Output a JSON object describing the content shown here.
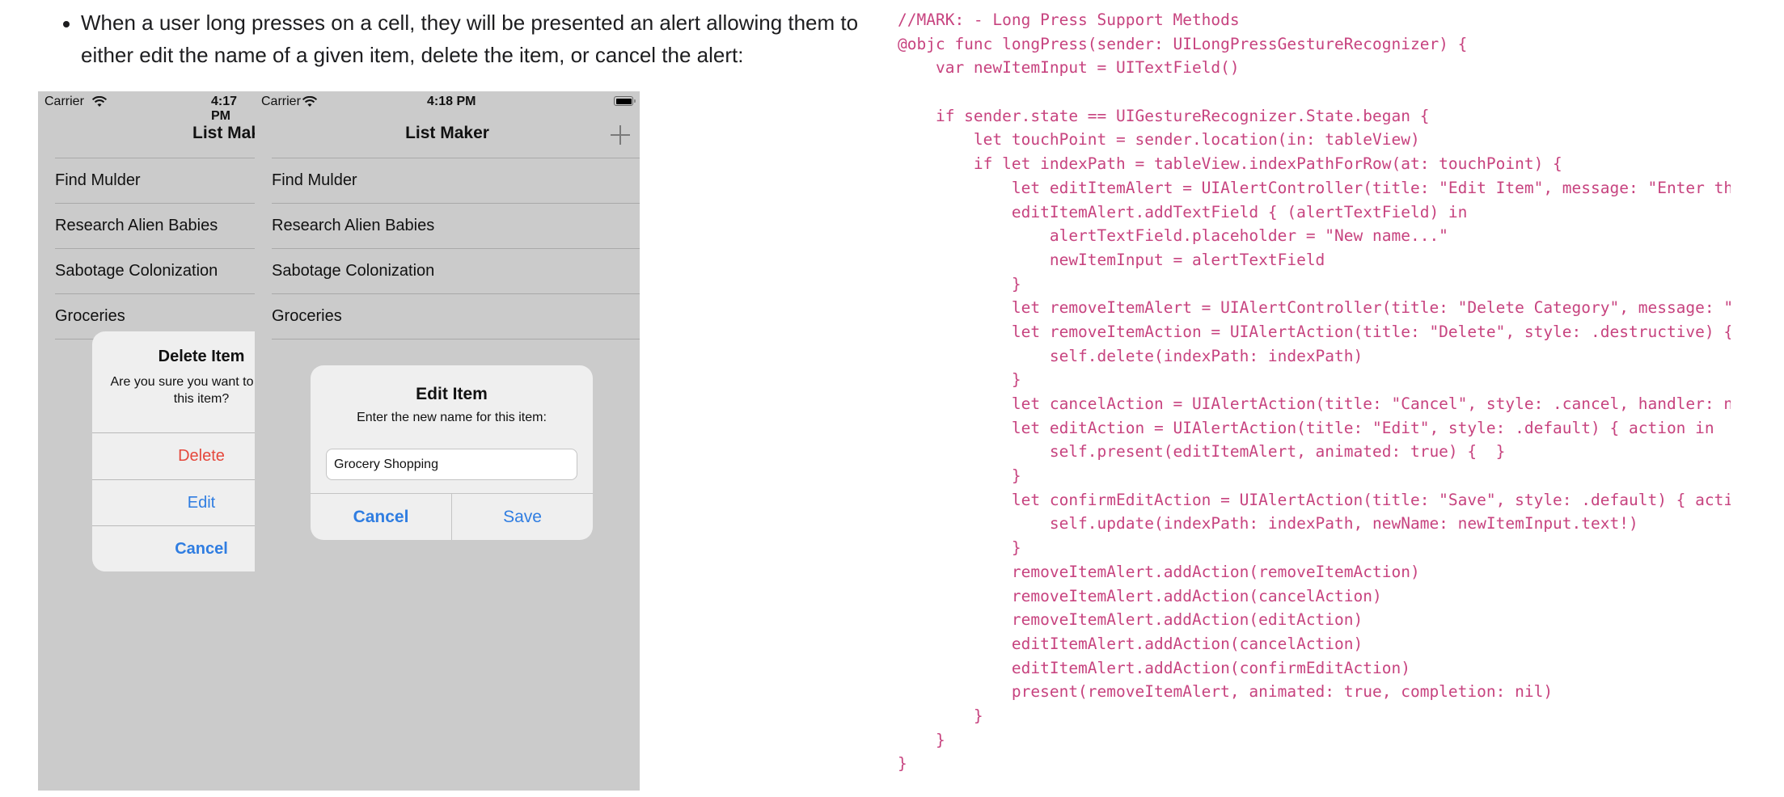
{
  "intro": {
    "text": "When a user long presses on a cell, they will be presented an alert allowing them to either edit the name of a given item, delete the item, or cancel the alert:"
  },
  "phone1": {
    "status": {
      "carrier": "Carrier",
      "time": "4:17 PM"
    },
    "nav_title": "List Maker",
    "items": [
      "Find Mulder",
      "Research Alien Babies",
      "Sabotage Colonization",
      "Groceries"
    ],
    "alert": {
      "title": "Delete Item",
      "message": "Are you sure you want to delete this item?",
      "actions": [
        {
          "label": "Delete",
          "style": "destructive"
        },
        {
          "label": "Edit",
          "style": "default"
        },
        {
          "label": "Cancel",
          "style": "cancel"
        }
      ]
    }
  },
  "phone2": {
    "status": {
      "carrier": "Carrier",
      "time": "4:18 PM"
    },
    "nav_title": "List Maker",
    "add_icon": "plus-icon",
    "items": [
      "Find Mulder",
      "Research Alien Babies",
      "Sabotage Colonization",
      "Groceries"
    ],
    "alert": {
      "title": "Edit Item",
      "message": "Enter the new name for this item:",
      "field_value": "Grocery Shopping",
      "cancel_label": "Cancel",
      "save_label": "Save"
    }
  },
  "colors": {
    "code": "#c7437f",
    "destructive": "#e5483c",
    "tint": "#2f7de1",
    "dimmed_background": "#cbcbcb"
  },
  "code_lines": [
    "//MARK: - Long Press Support Methods",
    "@objc func longPress(sender: UILongPressGestureRecognizer) {",
    "    var newItemInput = UITextField()",
    "",
    "    if sender.state == UIGestureRecognizer.State.began {",
    "        let touchPoint = sender.location(in: tableView)",
    "        if let indexPath = tableView.indexPathForRow(at: touchPoint) {",
    "            let editItemAlert = UIAlertController(title: \"Edit Item\", message: \"Enter the new name for this item:\", preferredStyle: .alert)",
    "            editItemAlert.addTextField { (alertTextField) in",
    "                alertTextField.placeholder = \"New name...\"",
    "                newItemInput = alertTextField",
    "            }",
    "            let removeItemAlert = UIAlertController(title: \"Delete Category\", message: \"Are you sure you want to delete this item?\", preferredStyle: .alert)",
    "            let removeItemAction = UIAlertAction(title: \"Delete\", style: .destructive) { action in",
    "                self.delete(indexPath: indexPath)",
    "            }",
    "            let cancelAction = UIAlertAction(title: \"Cancel\", style: .cancel, handler: nil)",
    "            let editAction = UIAlertAction(title: \"Edit\", style: .default) { action in",
    "                self.present(editItemAlert, animated: true) {  }",
    "            }",
    "            let confirmEditAction = UIAlertAction(title: \"Save\", style: .default) { action in",
    "                self.update(indexPath: indexPath, newName: newItemInput.text!)",
    "            }",
    "            removeItemAlert.addAction(removeItemAction)",
    "            removeItemAlert.addAction(cancelAction)",
    "            removeItemAlert.addAction(editAction)",
    "            editItemAlert.addAction(cancelAction)",
    "            editItemAlert.addAction(confirmEditAction)",
    "            present(removeItemAlert, animated: true, completion: nil)",
    "        }",
    "    }",
    "}"
  ]
}
